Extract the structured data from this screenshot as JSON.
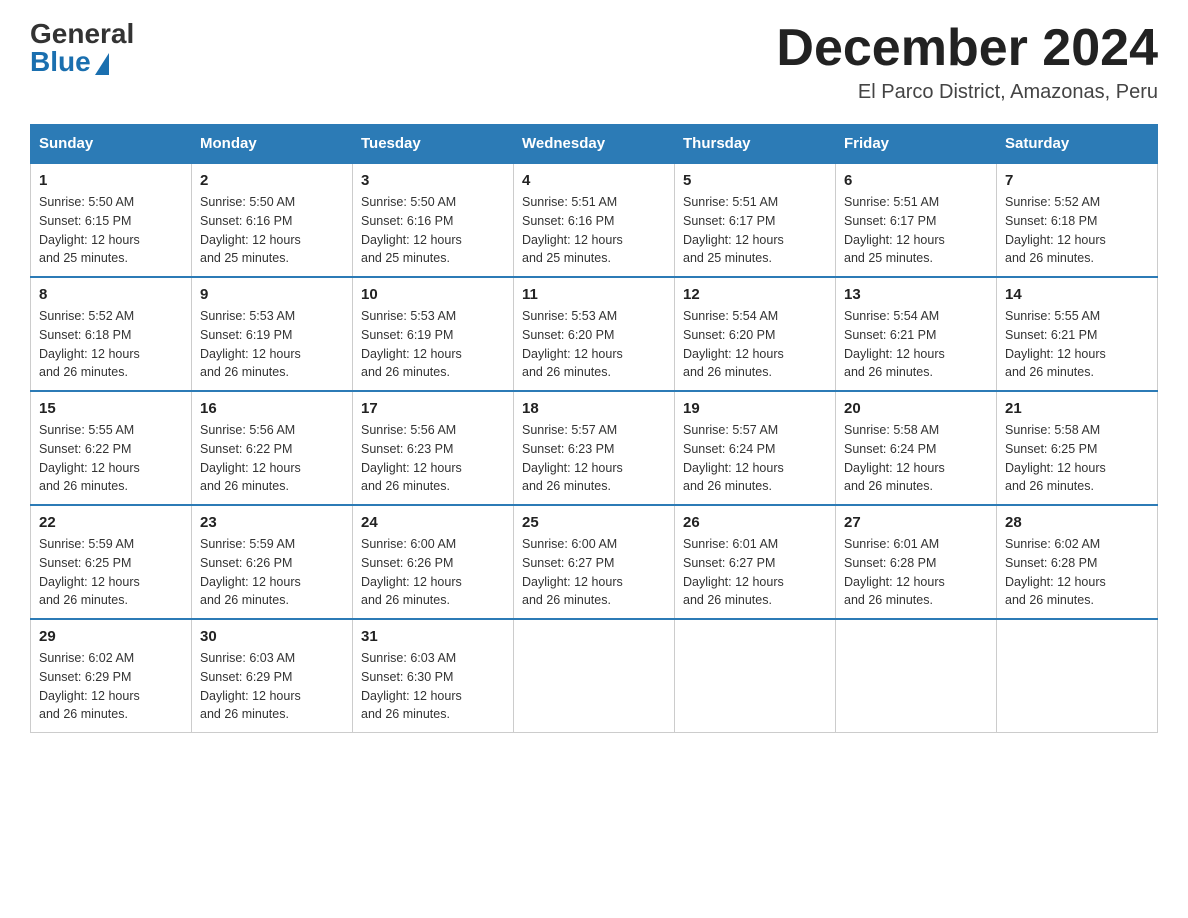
{
  "logo": {
    "general": "General",
    "blue": "Blue"
  },
  "header": {
    "month": "December 2024",
    "location": "El Parco District, Amazonas, Peru"
  },
  "days_of_week": [
    "Sunday",
    "Monday",
    "Tuesday",
    "Wednesday",
    "Thursday",
    "Friday",
    "Saturday"
  ],
  "weeks": [
    [
      {
        "day": "1",
        "sunrise": "5:50 AM",
        "sunset": "6:15 PM",
        "daylight": "12 hours and 25 minutes."
      },
      {
        "day": "2",
        "sunrise": "5:50 AM",
        "sunset": "6:16 PM",
        "daylight": "12 hours and 25 minutes."
      },
      {
        "day": "3",
        "sunrise": "5:50 AM",
        "sunset": "6:16 PM",
        "daylight": "12 hours and 25 minutes."
      },
      {
        "day": "4",
        "sunrise": "5:51 AM",
        "sunset": "6:16 PM",
        "daylight": "12 hours and 25 minutes."
      },
      {
        "day": "5",
        "sunrise": "5:51 AM",
        "sunset": "6:17 PM",
        "daylight": "12 hours and 25 minutes."
      },
      {
        "day": "6",
        "sunrise": "5:51 AM",
        "sunset": "6:17 PM",
        "daylight": "12 hours and 25 minutes."
      },
      {
        "day": "7",
        "sunrise": "5:52 AM",
        "sunset": "6:18 PM",
        "daylight": "12 hours and 26 minutes."
      }
    ],
    [
      {
        "day": "8",
        "sunrise": "5:52 AM",
        "sunset": "6:18 PM",
        "daylight": "12 hours and 26 minutes."
      },
      {
        "day": "9",
        "sunrise": "5:53 AM",
        "sunset": "6:19 PM",
        "daylight": "12 hours and 26 minutes."
      },
      {
        "day": "10",
        "sunrise": "5:53 AM",
        "sunset": "6:19 PM",
        "daylight": "12 hours and 26 minutes."
      },
      {
        "day": "11",
        "sunrise": "5:53 AM",
        "sunset": "6:20 PM",
        "daylight": "12 hours and 26 minutes."
      },
      {
        "day": "12",
        "sunrise": "5:54 AM",
        "sunset": "6:20 PM",
        "daylight": "12 hours and 26 minutes."
      },
      {
        "day": "13",
        "sunrise": "5:54 AM",
        "sunset": "6:21 PM",
        "daylight": "12 hours and 26 minutes."
      },
      {
        "day": "14",
        "sunrise": "5:55 AM",
        "sunset": "6:21 PM",
        "daylight": "12 hours and 26 minutes."
      }
    ],
    [
      {
        "day": "15",
        "sunrise": "5:55 AM",
        "sunset": "6:22 PM",
        "daylight": "12 hours and 26 minutes."
      },
      {
        "day": "16",
        "sunrise": "5:56 AM",
        "sunset": "6:22 PM",
        "daylight": "12 hours and 26 minutes."
      },
      {
        "day": "17",
        "sunrise": "5:56 AM",
        "sunset": "6:23 PM",
        "daylight": "12 hours and 26 minutes."
      },
      {
        "day": "18",
        "sunrise": "5:57 AM",
        "sunset": "6:23 PM",
        "daylight": "12 hours and 26 minutes."
      },
      {
        "day": "19",
        "sunrise": "5:57 AM",
        "sunset": "6:24 PM",
        "daylight": "12 hours and 26 minutes."
      },
      {
        "day": "20",
        "sunrise": "5:58 AM",
        "sunset": "6:24 PM",
        "daylight": "12 hours and 26 minutes."
      },
      {
        "day": "21",
        "sunrise": "5:58 AM",
        "sunset": "6:25 PM",
        "daylight": "12 hours and 26 minutes."
      }
    ],
    [
      {
        "day": "22",
        "sunrise": "5:59 AM",
        "sunset": "6:25 PM",
        "daylight": "12 hours and 26 minutes."
      },
      {
        "day": "23",
        "sunrise": "5:59 AM",
        "sunset": "6:26 PM",
        "daylight": "12 hours and 26 minutes."
      },
      {
        "day": "24",
        "sunrise": "6:00 AM",
        "sunset": "6:26 PM",
        "daylight": "12 hours and 26 minutes."
      },
      {
        "day": "25",
        "sunrise": "6:00 AM",
        "sunset": "6:27 PM",
        "daylight": "12 hours and 26 minutes."
      },
      {
        "day": "26",
        "sunrise": "6:01 AM",
        "sunset": "6:27 PM",
        "daylight": "12 hours and 26 minutes."
      },
      {
        "day": "27",
        "sunrise": "6:01 AM",
        "sunset": "6:28 PM",
        "daylight": "12 hours and 26 minutes."
      },
      {
        "day": "28",
        "sunrise": "6:02 AM",
        "sunset": "6:28 PM",
        "daylight": "12 hours and 26 minutes."
      }
    ],
    [
      {
        "day": "29",
        "sunrise": "6:02 AM",
        "sunset": "6:29 PM",
        "daylight": "12 hours and 26 minutes."
      },
      {
        "day": "30",
        "sunrise": "6:03 AM",
        "sunset": "6:29 PM",
        "daylight": "12 hours and 26 minutes."
      },
      {
        "day": "31",
        "sunrise": "6:03 AM",
        "sunset": "6:30 PM",
        "daylight": "12 hours and 26 minutes."
      },
      null,
      null,
      null,
      null
    ]
  ],
  "labels": {
    "sunrise": "Sunrise:",
    "sunset": "Sunset:",
    "daylight": "Daylight:"
  }
}
